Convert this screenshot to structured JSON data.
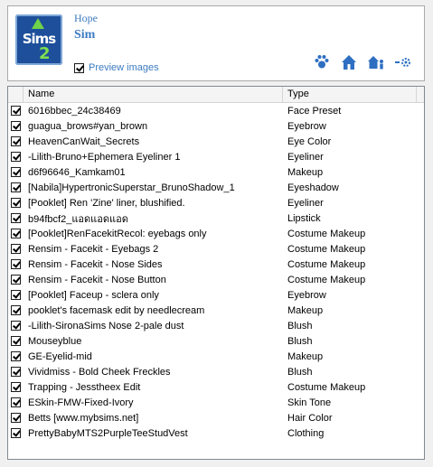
{
  "sim": {
    "first_name": "Hope",
    "last_name": "Sim"
  },
  "logo": {
    "line1": "Sims",
    "line2": "2"
  },
  "preview": {
    "label": "Preview images",
    "checked": true
  },
  "toolbar": {
    "icons": [
      "paw-icon",
      "house-icon",
      "family-house-icon",
      "relationship-icon"
    ],
    "accent": "#3c7bc1"
  },
  "list": {
    "columns": [
      "Name",
      "Type"
    ],
    "rows": [
      {
        "name": "6016bbec_24c38469",
        "type": "Face Preset",
        "checked": true
      },
      {
        "name": "guagua_brows#yan_brown",
        "type": "Eyebrow",
        "checked": true
      },
      {
        "name": "HeavenCanWait_Secrets",
        "type": "Eye Color",
        "checked": true
      },
      {
        "name": "-Lilith-Bruno+Ephemera Eyeliner 1",
        "type": "Eyeliner",
        "checked": true
      },
      {
        "name": "d6f96646_Kamkam01",
        "type": "Makeup",
        "checked": true
      },
      {
        "name": "[Nabila]HypertronicSuperstar_BrunoShadow_1",
        "type": "Eyeshadow",
        "checked": true
      },
      {
        "name": "[Pooklet] Ren 'Zine' liner, blushified.",
        "type": "Eyeliner",
        "checked": true
      },
      {
        "name": "b94fbcf2_แอดแอดแอด",
        "type": "Lipstick",
        "checked": true
      },
      {
        "name": "[Pooklet]RenFacekitRecol: eyebags only",
        "type": "Costume Makeup",
        "checked": true
      },
      {
        "name": "Rensim - Facekit - Eyebags 2",
        "type": "Costume Makeup",
        "checked": true
      },
      {
        "name": "Rensim - Facekit - Nose Sides",
        "type": "Costume Makeup",
        "checked": true
      },
      {
        "name": "Rensim - Facekit - Nose Button",
        "type": "Costume Makeup",
        "checked": true
      },
      {
        "name": "[Pooklet] Faceup - sclera only",
        "type": "Eyebrow",
        "checked": true
      },
      {
        "name": "pooklet's facemask edit by needlecream",
        "type": "Makeup",
        "checked": true
      },
      {
        "name": "-Lilith-SironaSims Nose 2-pale dust",
        "type": "Blush",
        "checked": true
      },
      {
        "name": "Mouseyblue",
        "type": "Blush",
        "checked": true
      },
      {
        "name": "GE-Eyelid-mid",
        "type": "Makeup",
        "checked": true
      },
      {
        "name": "Vividmiss - Bold Cheek Freckles",
        "type": "Blush",
        "checked": true
      },
      {
        "name": "Trapping - Jesstheex Edit",
        "type": "Costume Makeup",
        "checked": true
      },
      {
        "name": "ESkin-FMW-Fixed-Ivory",
        "type": "Skin Tone",
        "checked": true
      },
      {
        "name": "Betts [www.mybsims.net]",
        "type": "Hair Color",
        "checked": true
      },
      {
        "name": "PrettyBabyMTS2PurpleTeeStudVest",
        "type": "Clothing",
        "checked": true
      }
    ]
  }
}
